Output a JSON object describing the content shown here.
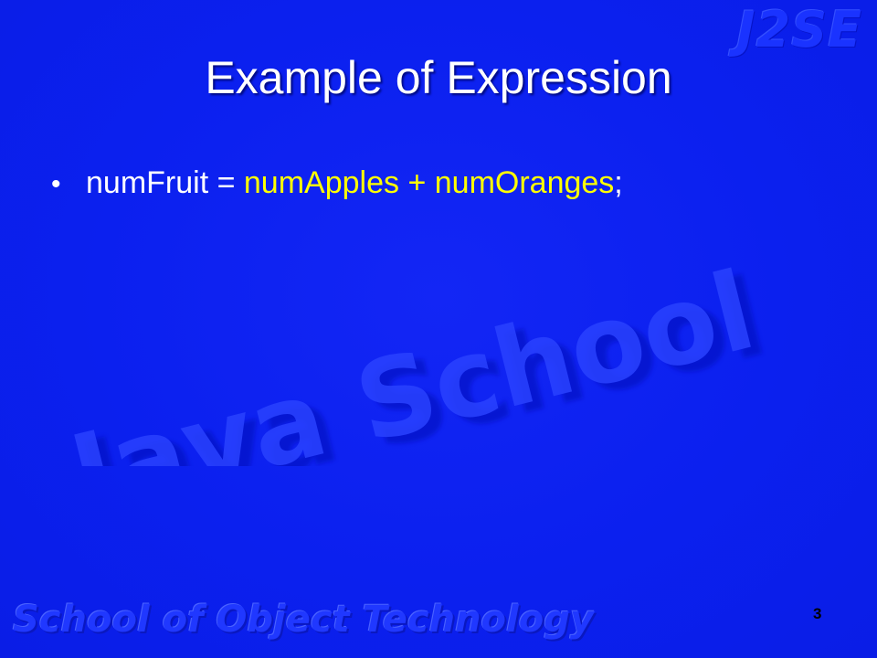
{
  "slide": {
    "watermark_top": "J2SE",
    "watermark_center": "Java School",
    "watermark_footer": "School of Object Technology",
    "title": "Example of Expression",
    "bullets": [
      {
        "symbol": "•",
        "parts": {
          "lhs": "numFruit = ",
          "operand1": "numApples",
          "op": " + ",
          "operand2": "numOranges",
          "end": ";"
        }
      }
    ],
    "page_number": "3"
  },
  "colors": {
    "background": "#0a1ff0",
    "text": "#ffffff",
    "highlight": "#ffff00"
  }
}
